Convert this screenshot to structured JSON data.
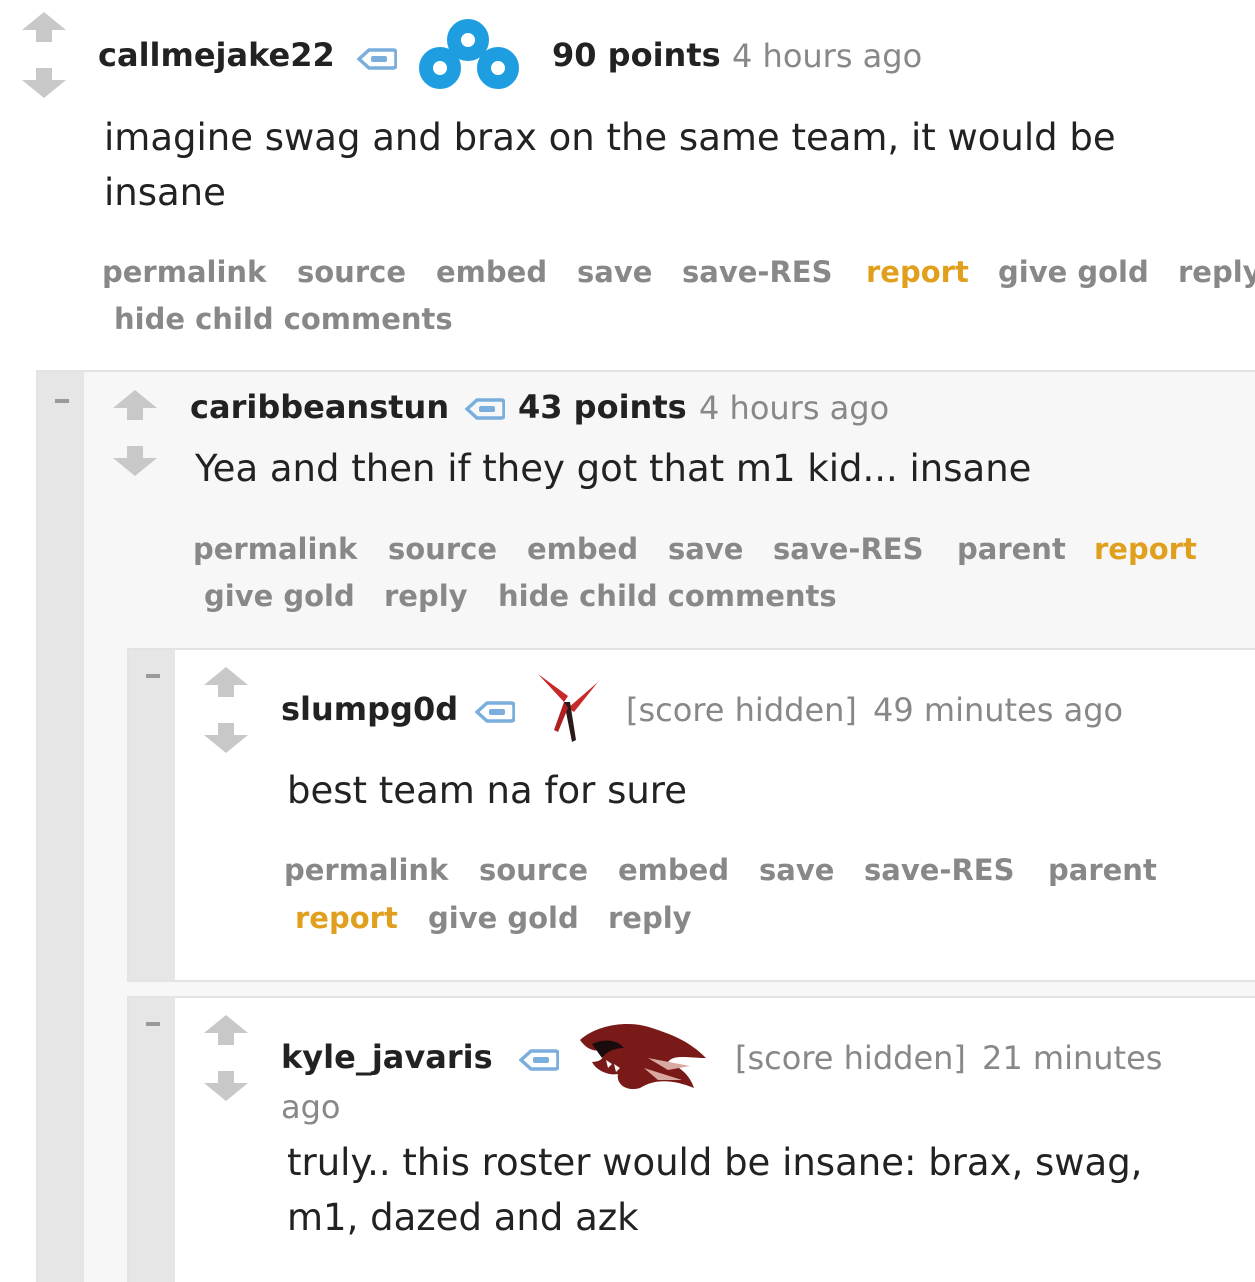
{
  "comments": [
    {
      "username": "callmejake22",
      "flair_icon": "cloud9-logo-icon",
      "score": "90 points",
      "time": "4 hours ago",
      "body_line1": "imagine swag and brax on the same team, it would be",
      "body_line2": "insane",
      "actions": [
        "permalink",
        "source",
        "embed",
        "save",
        "save-RES",
        "report",
        "give gold",
        "reply"
      ],
      "actions_line2": [
        "hide child comments"
      ]
    },
    {
      "username": "caribbeanstun",
      "score": "43 points",
      "time": "4 hours ago",
      "body_line1": "Yea and then if they got that m1 kid... insane",
      "actions": [
        "permalink",
        "source",
        "embed",
        "save",
        "save-RES",
        "parent",
        "report"
      ],
      "actions_line2": [
        "give gold",
        "reply",
        "hide child comments"
      ]
    },
    {
      "username": "slumpg0d",
      "flair_icon": "red-x-logo-icon",
      "score": "[score hidden]",
      "time": "49 minutes ago",
      "body_line1": "best team na for sure",
      "actions": [
        "permalink",
        "source",
        "embed",
        "save",
        "save-RES",
        "parent"
      ],
      "actions_line2": [
        "report",
        "give gold",
        "reply"
      ]
    },
    {
      "username": "kyle_javaris",
      "flair_icon": "red-wolf-logo-icon",
      "score": "[score hidden]",
      "time_part1": "21 minutes",
      "time_part2": "ago",
      "body_line1": "truly.. this roster would be insane: brax, swag,",
      "body_line2": "m1, dazed and azk"
    }
  ],
  "collapse_symbol": "–",
  "colors": {
    "report": "#e0a01e",
    "action": "#888888",
    "cloud9_blue": "#1e9ee0",
    "tag_blue": "#5b9bd5"
  }
}
